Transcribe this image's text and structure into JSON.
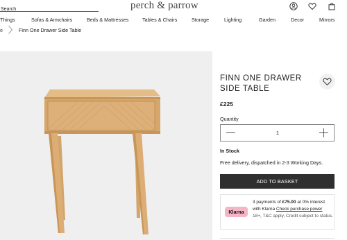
{
  "header": {
    "search_placeholder": "Search",
    "logo": "perch & parrow",
    "icons": [
      "account-icon",
      "wishlist-icon",
      "basket-icon"
    ]
  },
  "nav": {
    "items": [
      "Things",
      "Sofas & Armchairs",
      "Beds & Mattresses",
      "Tables & Chairs",
      "Storage",
      "Lighting",
      "Garden",
      "Decor",
      "Mirrors"
    ]
  },
  "breadcrumb": {
    "home": "e",
    "current": "Finn One Drawer Side Table"
  },
  "product": {
    "title": "FINN ONE DRAWER SIDE TABLE",
    "price": "£225",
    "quantity_label": "Quantity",
    "quantity": "1",
    "stock": "In Stock",
    "delivery": "Free delivery, dispatched in 2-3 Working Days.",
    "add_to_basket": "ADD TO BASKET"
  },
  "klarna": {
    "logo": "Klarna",
    "line_pre": "3 payments of ",
    "amount": "£75.00",
    "line_post": " at 0% interest with Klarna ",
    "link": "Check purchase power",
    "terms": "18+, T&C apply, Credit subject to status."
  },
  "colors": {
    "button_bg": "#2f2f2f",
    "klarna_pink": "#f4b6c7",
    "gallery_bg": "#efefef",
    "wood": "#d9ae77"
  }
}
